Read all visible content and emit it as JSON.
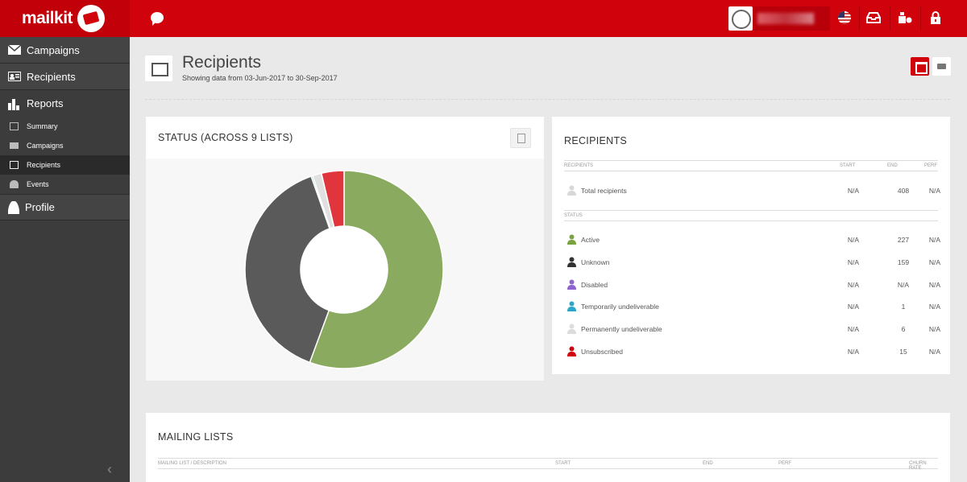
{
  "header": {
    "logo_text": "mailkit",
    "icons": [
      "chat-icon",
      "flag-us-icon",
      "inbox-icon",
      "account-icon",
      "lock-icon"
    ]
  },
  "sidebar": {
    "items": [
      {
        "label": "Campaigns",
        "icon": "mail-icon"
      },
      {
        "label": "Recipients",
        "icon": "id-card-icon"
      },
      {
        "label": "Reports",
        "icon": "bar-chart-icon"
      },
      {
        "label": "Profile",
        "icon": "user-icon"
      }
    ],
    "sub_items": [
      {
        "label": "Summary",
        "icon": "clipboard-icon"
      },
      {
        "label": "Campaigns",
        "icon": "mail-icon"
      },
      {
        "label": "Recipients",
        "icon": "id-card-icon",
        "active": true
      },
      {
        "label": "Events",
        "icon": "bell-icon"
      }
    ],
    "collapse_glyph": "‹"
  },
  "page": {
    "title": "Recipients",
    "subtitle": "Showing data from 03-Jun-2017 to 30-Sep-2017"
  },
  "status_panel": {
    "title": "STATUS (ACROSS 9 LISTS)",
    "chart_data": {
      "type": "pie",
      "categories": [
        "Active",
        "Unknown",
        "Disabled",
        "Temporarily undeliverable",
        "Permanently undeliverable",
        "Unsubscribed"
      ],
      "values": [
        227,
        159,
        0,
        1,
        6,
        15
      ],
      "colors": [
        "#8aab5f",
        "#5a5a5a",
        "#9370cc",
        "#2aa6c9",
        "#e0e0e0",
        "#e0353d"
      ],
      "donut": true
    }
  },
  "recipients_panel": {
    "title": "RECIPIENTS",
    "columns": [
      "RECIPIENTS",
      "START",
      "END",
      "PERF"
    ],
    "status_header": "STATUS",
    "total": {
      "label": "Total recipients",
      "start": "N/A",
      "end": "408",
      "perf": "N/A",
      "color": "#d8d8d8"
    },
    "rows": [
      {
        "label": "Active",
        "start": "N/A",
        "end": "227",
        "perf": "N/A",
        "color": "#7aa33f"
      },
      {
        "label": "Unknown",
        "start": "N/A",
        "end": "159",
        "perf": "N/A",
        "color": "#333333"
      },
      {
        "label": "Disabled",
        "start": "N/A",
        "end": "N/A",
        "perf": "N/A",
        "color": "#8f64cf"
      },
      {
        "label": "Temporarily undeliverable",
        "start": "N/A",
        "end": "1",
        "perf": "N/A",
        "color": "#2aa6c9"
      },
      {
        "label": "Permanently undeliverable",
        "start": "N/A",
        "end": "6",
        "perf": "N/A",
        "color": "#dcdcdc"
      },
      {
        "label": "Unsubscribed",
        "start": "N/A",
        "end": "15",
        "perf": "N/A",
        "color": "#d0020c"
      }
    ]
  },
  "mailing_panel": {
    "title": "MAILING LISTS",
    "columns": [
      "MAILING LIST / DESCRIPTION",
      "START",
      "END",
      "PERF",
      "CHURN RATE"
    ]
  }
}
